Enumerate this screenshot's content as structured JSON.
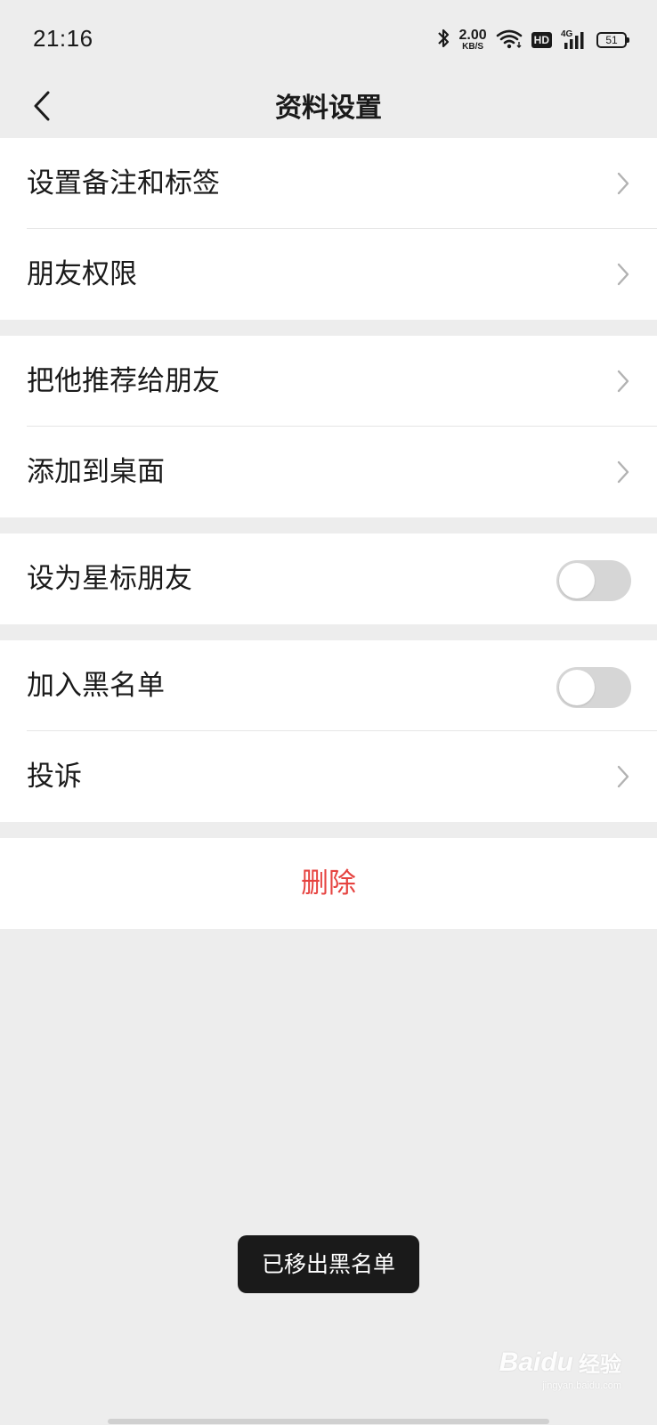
{
  "status_bar": {
    "time": "21:16",
    "net_speed_value": "2.00",
    "net_speed_unit": "KB/S",
    "hd_label": "HD",
    "network_label": "4G",
    "battery_level": "51",
    "icons": [
      "bluetooth-icon",
      "wifi-icon",
      "hd-icon",
      "signal-4g-icon",
      "battery-icon"
    ]
  },
  "nav": {
    "title": "资料设置",
    "back_icon": "chevron-left-icon"
  },
  "groups": [
    {
      "items": [
        {
          "label": "设置备注和标签",
          "type": "link"
        },
        {
          "label": "朋友权限",
          "type": "link"
        }
      ]
    },
    {
      "items": [
        {
          "label": "把他推荐给朋友",
          "type": "link"
        },
        {
          "label": "添加到桌面",
          "type": "link"
        }
      ]
    },
    {
      "items": [
        {
          "label": "设为星标朋友",
          "type": "toggle",
          "on": false
        }
      ]
    },
    {
      "items": [
        {
          "label": "加入黑名单",
          "type": "toggle",
          "on": false
        },
        {
          "label": "投诉",
          "type": "link"
        }
      ]
    }
  ],
  "delete_label": "删除",
  "toast": "已移出黑名单",
  "watermark": {
    "brand": "Baidu",
    "sub": "经验",
    "url": "jingyan.baidu.com"
  },
  "colors": {
    "background": "#ededed",
    "danger": "#e64340",
    "toggle_off": "#d6d6d6",
    "toast_bg": "#1a1a1a"
  }
}
